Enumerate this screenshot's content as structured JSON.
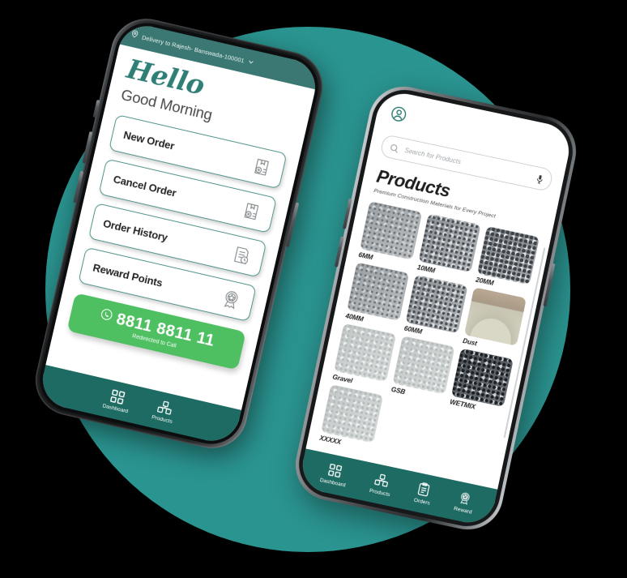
{
  "theme": {
    "circle_color": "#2a9490",
    "topbar_color": "#3c7873",
    "nav_color": "#1d6b62",
    "accent_teal": "#2f7f77",
    "call_green": "#4fc062",
    "card_border": "#52958d",
    "background": "#000000"
  },
  "phone_left": {
    "topbar": {
      "location_icon": "location-pin-icon",
      "address": "Delivery to Rajesh- Banswada-100001",
      "chevron": "chevron-down-icon"
    },
    "greeting": {
      "hello": "Hello",
      "time_of_day": "Good Morning"
    },
    "menu": [
      {
        "label": "New Order",
        "icon": "box-plus-icon"
      },
      {
        "label": "Cancel Order",
        "icon": "box-cross-icon"
      },
      {
        "label": "Order History",
        "icon": "document-clock-icon"
      },
      {
        "label": "Reward Points",
        "icon": "award-ribbon-icon"
      }
    ],
    "call": {
      "icon": "phone-circle-icon",
      "number": "8811 8811 11",
      "caption": "Redirected to Call"
    },
    "nav": [
      {
        "label": "Dashboard",
        "icon": "grid-dashboard-icon",
        "active": true
      },
      {
        "label": "Products",
        "icon": "boxes-icon",
        "active": false
      }
    ]
  },
  "phone_right": {
    "avatar_icon": "user-circle-icon",
    "search": {
      "icon": "search-icon",
      "placeholder": "Search for Products",
      "value": "",
      "mic_icon": "microphone-icon"
    },
    "title": "Products",
    "subtitle": "Premium Construction Materials for Every Project",
    "products": [
      {
        "label": "6MM",
        "texture": "tex-a"
      },
      {
        "label": "10MM",
        "texture": "tex-b"
      },
      {
        "label": "20MM",
        "texture": "tex-c"
      },
      {
        "label": "40MM",
        "texture": "tex-a"
      },
      {
        "label": "60MM",
        "texture": "tex-b"
      },
      {
        "label": "Dust",
        "texture": "tex-sand"
      },
      {
        "label": "Gravel",
        "texture": "tex-light"
      },
      {
        "label": "GSB",
        "texture": "tex-light"
      },
      {
        "label": "WETMIX",
        "texture": "tex-dark"
      },
      {
        "label": "XXXXX",
        "texture": "tex-light"
      }
    ],
    "nav": [
      {
        "label": "Dashboard",
        "icon": "grid-dashboard-icon",
        "active": false
      },
      {
        "label": "Products",
        "icon": "boxes-icon",
        "active": true
      },
      {
        "label": "Orders",
        "icon": "clipboard-list-icon",
        "active": false
      },
      {
        "label": "Reward",
        "icon": "award-ribbon-icon",
        "active": false
      }
    ]
  }
}
